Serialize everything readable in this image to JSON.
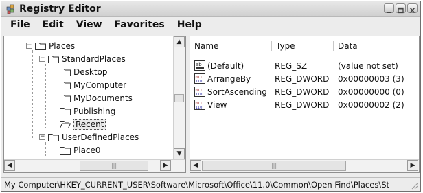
{
  "window": {
    "title": "Registry Editor",
    "icon": "registry-editor-icon",
    "buttons": [
      "minimize-icon",
      "maximize-icon",
      "close-icon"
    ]
  },
  "menu": [
    "File",
    "Edit",
    "View",
    "Favorites",
    "Help"
  ],
  "tree": [
    {
      "label": "Places",
      "expanded": true
    },
    {
      "label": "StandardPlaces",
      "expanded": true
    },
    {
      "label": "Desktop"
    },
    {
      "label": "MyComputer"
    },
    {
      "label": "MyDocuments"
    },
    {
      "label": "Publishing"
    },
    {
      "label": "Recent",
      "selected": true
    },
    {
      "label": "UserDefinedPlaces",
      "expanded": true
    },
    {
      "label": "Place0"
    }
  ],
  "columns": [
    "Name",
    "Type",
    "Data"
  ],
  "values": [
    {
      "name": "(Default)",
      "type": "REG_SZ",
      "data": "(value not set)",
      "icon": "string-value-icon"
    },
    {
      "name": "ArrangeBy",
      "type": "REG_DWORD",
      "data": "0x00000003 (3)",
      "icon": "binary-value-icon"
    },
    {
      "name": "SortAscending",
      "type": "REG_DWORD",
      "data": "0x00000000 (0)",
      "icon": "binary-value-icon"
    },
    {
      "name": "View",
      "type": "REG_DWORD",
      "data": "0x00000002 (2)",
      "icon": "binary-value-icon"
    }
  ],
  "status": "My Computer\\HKEY_CURRENT_USER\\Software\\Microsoft\\Office\\11.0\\Common\\Open Find\\Places\\St",
  "scrollbars": {
    "arrow_up": "▲",
    "arrow_down": "▼",
    "arrow_left": "◀",
    "arrow_right": "▶",
    "grip": "|||"
  }
}
